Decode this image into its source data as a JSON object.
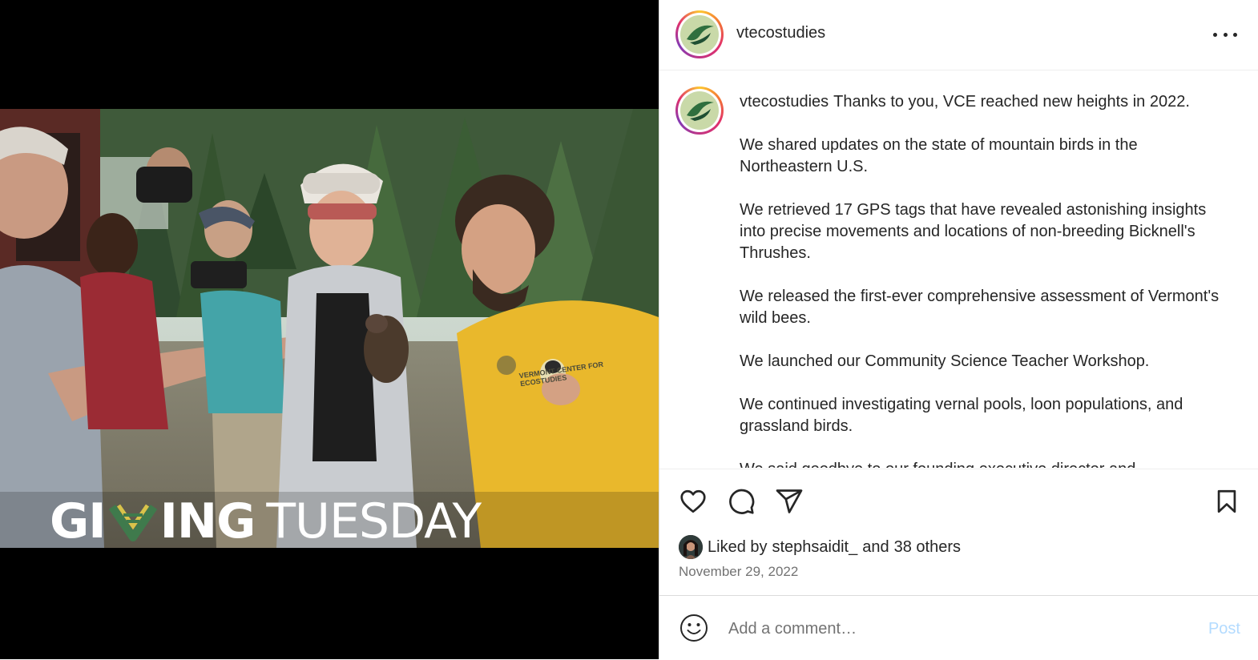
{
  "post": {
    "username": "vtecostudies",
    "more_icon": "more-horizontal-icon",
    "image_overlay": {
      "brand_left": "GI",
      "brand_mid": "ING",
      "brand_right": "TUESDAY",
      "shirt_text": "VERMONT CENTER FOR ECOSTUDIES"
    }
  },
  "caption": {
    "username": "vtecostudies",
    "paragraphs": [
      "Thanks to you, VCE reached new heights in 2022.",
      "We shared updates on the state of mountain birds in the Northeastern U.S.",
      "We retrieved 17 GPS tags that have revealed astonishing insights into precise movements and locations of non-breeding Bicknell's Thrushes.",
      "We released the first-ever comprehensive assessment of Vermont's wild bees.",
      "We launched our Community Science Teacher Workshop.",
      "We continued investigating vernal pools, loon populations, and grassland birds.",
      "We said goodbye to our founding executive director and"
    ]
  },
  "actions": {
    "icons": [
      "heart-icon",
      "comment-icon",
      "share-icon",
      "bookmark-icon"
    ]
  },
  "likes": {
    "prefix": "Liked by",
    "user": "stephsaidit_",
    "and": "and",
    "others": "38 others"
  },
  "date": "November 29, 2022",
  "comment": {
    "placeholder": "Add a comment…",
    "post_label": "Post"
  },
  "colors": {
    "post_disabled": "#b3dbff",
    "secondary_text": "#737373",
    "shirt": "#e9b82c"
  }
}
